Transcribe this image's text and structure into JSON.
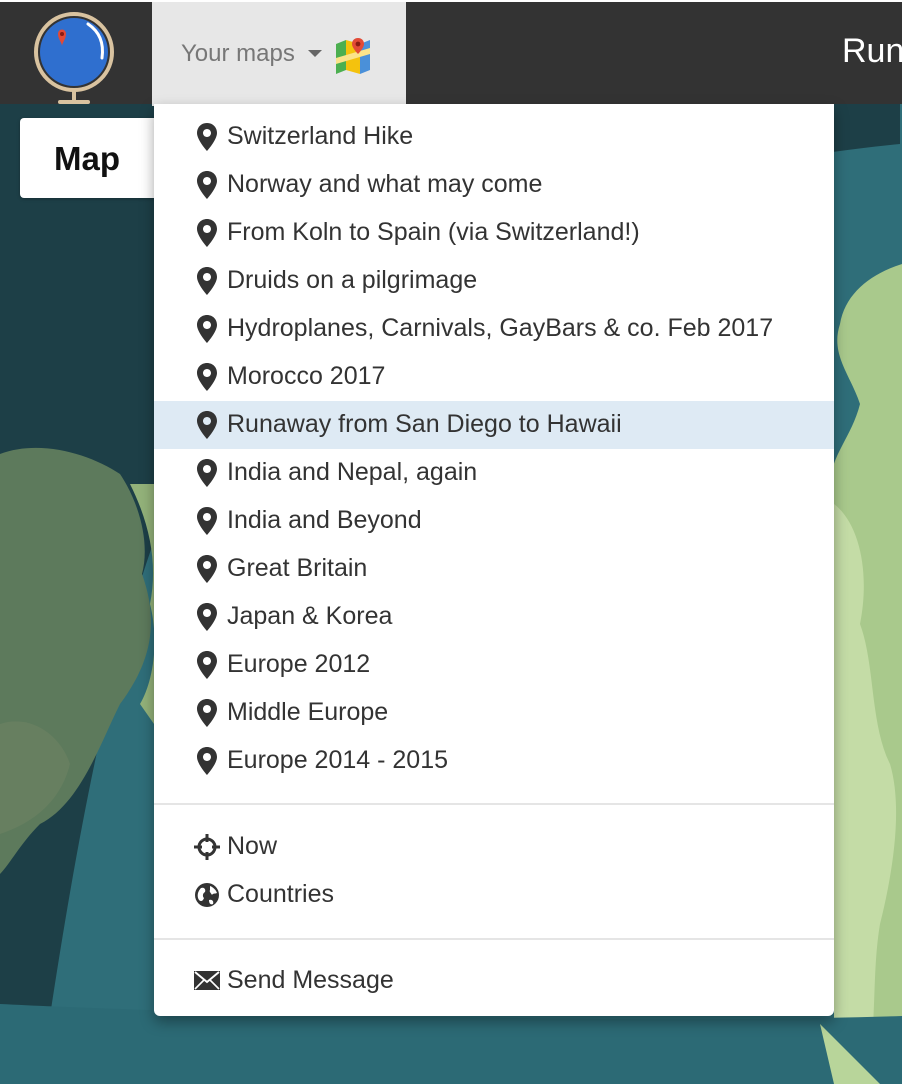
{
  "navbar": {
    "your_maps_label": "Your maps",
    "title": "Run",
    "logo_icon": "globe-logo-icon",
    "maps_icon": "google-maps-icon"
  },
  "map_button": {
    "label": "Map"
  },
  "dropdown": {
    "trips": [
      {
        "label": "Switzerland Hike",
        "icon": "map-marker-icon"
      },
      {
        "label": "Norway and what may come",
        "icon": "map-marker-icon"
      },
      {
        "label": "From Koln to Spain (via Switzerland!)",
        "icon": "map-marker-icon"
      },
      {
        "label": "Druids on a pilgrimage",
        "icon": "map-marker-icon"
      },
      {
        "label": "Hydroplanes, Carnivals, GayBars & co. Feb 2017",
        "icon": "map-marker-icon"
      },
      {
        "label": "Morocco 2017",
        "icon": "map-marker-icon"
      },
      {
        "label": "Runaway from San Diego to Hawaii",
        "icon": "map-marker-icon",
        "highlighted": true
      },
      {
        "label": "India and Nepal, again",
        "icon": "map-marker-icon"
      },
      {
        "label": "India and Beyond",
        "icon": "map-marker-icon"
      },
      {
        "label": "Great Britain",
        "icon": "map-marker-icon"
      },
      {
        "label": "Japan & Korea",
        "icon": "map-marker-icon"
      },
      {
        "label": "Europe 2012",
        "icon": "map-marker-icon"
      },
      {
        "label": "Middle Europe",
        "icon": "map-marker-icon"
      },
      {
        "label": "Europe 2014 - 2015",
        "icon": "map-marker-icon"
      }
    ],
    "views": [
      {
        "label": "Now",
        "icon": "crosshair-icon"
      },
      {
        "label": "Countries",
        "icon": "globe-icon"
      }
    ],
    "contact": [
      {
        "label": "Send Message",
        "icon": "envelope-icon"
      }
    ]
  },
  "colors": {
    "navbar_bg": "#333333",
    "dropdown_toggle_bg": "#e7e7e7",
    "highlight_bg": "#deeaf4",
    "ocean": "#2f6e79",
    "land": "#a9c98c"
  }
}
